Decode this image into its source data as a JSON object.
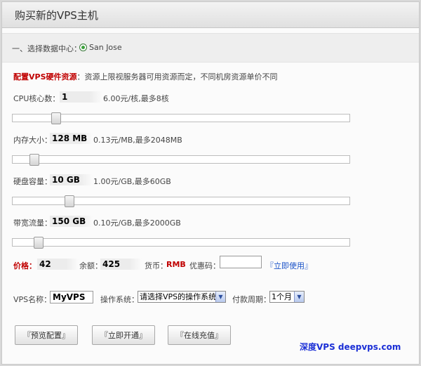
{
  "header": {
    "title": "购买新的VPS主机"
  },
  "datacenter": {
    "label": "一、选择数据中心：",
    "option": "San Jose"
  },
  "config": {
    "title": "配置VPS硬件资源",
    "note": "：资源上限视服务器可用资源而定，不同机房资源单价不同",
    "cpu": {
      "label": "CPU核心数：",
      "value": "1",
      "info": "6.00元/核,最多8核",
      "slider_fraction": 0.125
    },
    "mem": {
      "label": "内存大小：",
      "value": "128 MB",
      "info": "0.13元/MB,最多2048MB",
      "slider_fraction": 0.0625
    },
    "disk": {
      "label": "硬盘容量：",
      "value": "10 GB",
      "info": "1.00元/GB,最多60GB",
      "slider_fraction": 0.1667
    },
    "bw": {
      "label": "带宽流量：",
      "value": "150 GB",
      "info": "0.10元/GB,最多2000GB",
      "slider_fraction": 0.075
    }
  },
  "summary": {
    "price_label": "价格：",
    "price": "42",
    "balance_label": "余额：",
    "balance": "425",
    "currency_label": "货币：",
    "currency": "RMB",
    "coupon_label": "优惠码：",
    "coupon_value": "",
    "use_link": "『立即使用』"
  },
  "form": {
    "name_label": "VPS名称：",
    "name_value": "MyVPS",
    "os_label": "操作系统：",
    "os_value": "请选择VPS的操作系统",
    "period_label": "付款周期：",
    "period_value": "1个月"
  },
  "buttons": {
    "preview": "『预览配置』",
    "open": "『立即开通』",
    "recharge": "『在线充值』"
  },
  "brand": "深度VPS deepvps.com",
  "colors": {
    "accent_red": "#c00000",
    "link_blue": "#1a52c8",
    "brand_blue": "#1b2fd6"
  }
}
